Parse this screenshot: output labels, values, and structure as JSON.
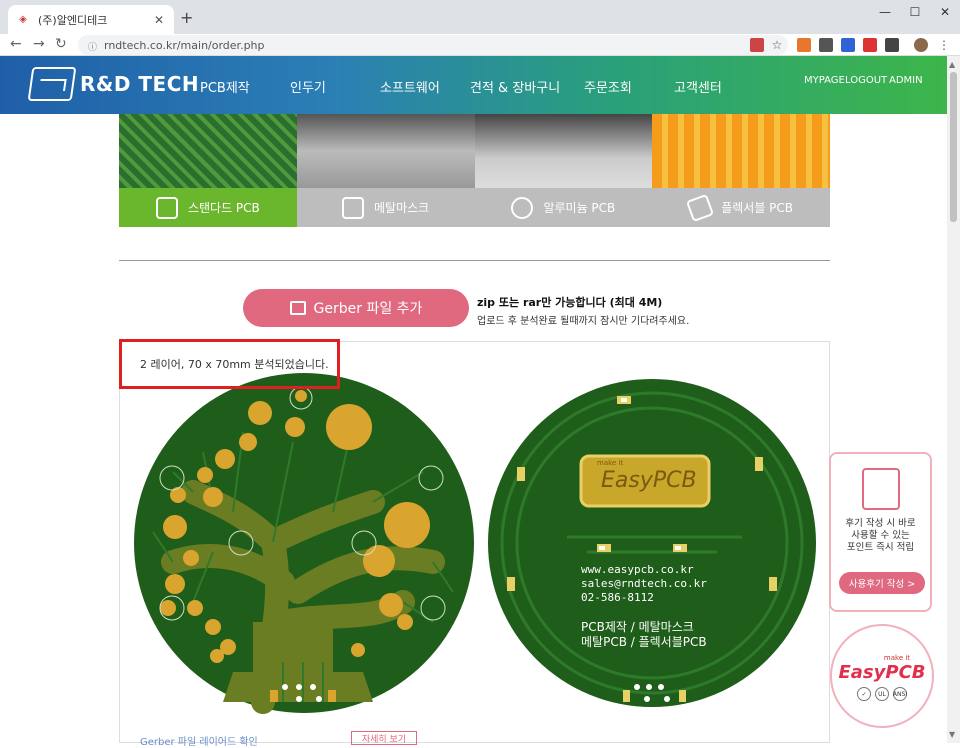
{
  "browser": {
    "tab_title": "(주)알엔디테크",
    "tab_favicon": "company-favicon",
    "new_tab": "+",
    "url": "rndtech.co.kr/main/order.php",
    "window_controls": [
      "—",
      "☐",
      "✕"
    ]
  },
  "header": {
    "logo_text": "R&D TECH",
    "nav": [
      "PCB제작",
      "인두기",
      "소프트웨어",
      "견적 & 장바구니",
      "주문조회",
      "고객센터"
    ],
    "util": [
      "MYPAGE",
      "LOGOUT",
      "ADMIN"
    ]
  },
  "product_tabs": [
    "스탠다드 PCB",
    "메탈마스크",
    "알루미늄 PCB",
    "플렉서블 PCB"
  ],
  "upload": {
    "button_label": "Gerber 파일 추가",
    "note_title": "zip 또는 rar만 가능합니다 (최대 4M)",
    "note_desc": "업로드 후 분석완료 될때까지 잠시만 기다려주세요."
  },
  "analysis_result": "2 레이어, 70 x 70mm 분석되었습니다.",
  "pcb_back": {
    "badge_small": "make it",
    "badge_main": "EasyPCB",
    "lines": [
      "www.easypcb.co.kr",
      "sales@rndtech.co.kr",
      "02-586-8112"
    ],
    "products_1": "PCB제작 / 메탈마스크",
    "products_2": "메탈PCB / 플렉서블PCB"
  },
  "side_promo": {
    "text_1": "후기 작성 시 바로",
    "text_2": "사용할 수 있는",
    "text_3": "포인트 즉시 적립",
    "button": "사용후기 작성 >"
  },
  "side_badge": {
    "small": "make it",
    "main": "EasyPCB",
    "certs": [
      "✓",
      "UL",
      "ANSI"
    ]
  },
  "bottom": {
    "link": "Gerber 파일 레이어드 확인",
    "button": "자세히 보기"
  },
  "colors": {
    "pcb_green": "#1f5d1a",
    "pad_gold": "#d9a52f",
    "accent_pink": "#e0697f",
    "active_tab": "#6ab62d"
  }
}
